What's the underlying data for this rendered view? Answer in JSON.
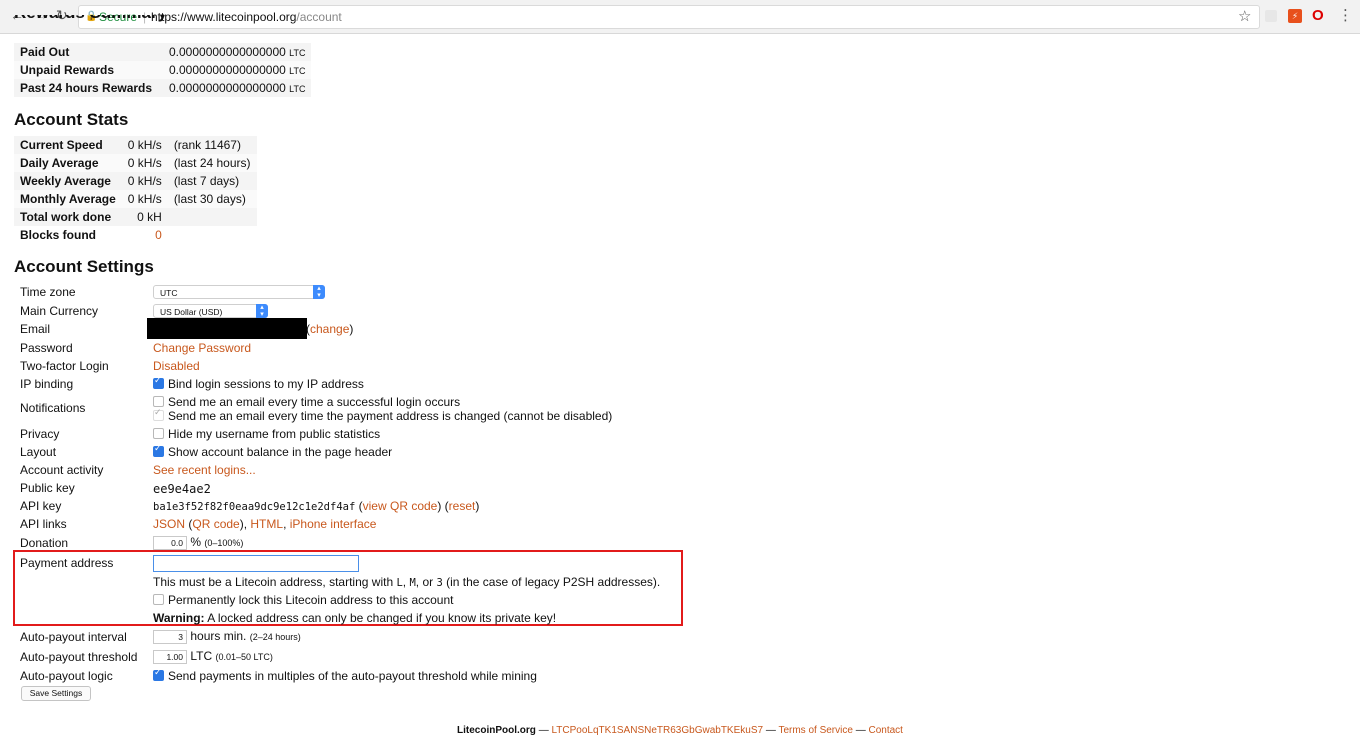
{
  "browser": {
    "secure_label": "Secure",
    "url_host": "https://www.litecoinpool.org",
    "url_path": "/account"
  },
  "rewards": {
    "heading": "Rewards Summary",
    "rows": [
      {
        "label": "Paid Out",
        "value": "0.0000000000000000",
        "unit": "LTC"
      },
      {
        "label": "Unpaid Rewards",
        "value": "0.0000000000000000",
        "unit": "LTC"
      },
      {
        "label": "Past 24 hours Rewards",
        "value": "0.0000000000000000",
        "unit": "LTC"
      }
    ]
  },
  "stats": {
    "heading": "Account Stats",
    "rows": [
      {
        "label": "Current Speed",
        "value": "0 kH/s",
        "note": "(rank 11467)"
      },
      {
        "label": "Daily Average",
        "value": "0 kH/s",
        "note": "(last 24 hours)"
      },
      {
        "label": "Weekly Average",
        "value": "0 kH/s",
        "note": "(last 7 days)"
      },
      {
        "label": "Monthly Average",
        "value": "0 kH/s",
        "note": "(last 30 days)"
      },
      {
        "label": "Total work done",
        "value": "0 kH",
        "note": ""
      },
      {
        "label": "Blocks found",
        "value": "0",
        "note": ""
      }
    ]
  },
  "settings": {
    "heading": "Account Settings",
    "timezone": {
      "label": "Time zone",
      "value": "UTC"
    },
    "currency": {
      "label": "Main Currency",
      "value": "US Dollar (USD)"
    },
    "email": {
      "label": "Email",
      "change": "change",
      "open_paren": "(",
      "close_paren": ")"
    },
    "password": {
      "label": "Password",
      "link": "Change Password"
    },
    "twofactor": {
      "label": "Two-factor Login",
      "link": "Disabled"
    },
    "ipbinding": {
      "label": "IP binding",
      "option": "Bind login sessions to my IP address"
    },
    "notifications": {
      "label": "Notifications",
      "option1": "Send me an email every time a successful login occurs",
      "option2": "Send me an email every time the payment address is changed (cannot be disabled)"
    },
    "privacy": {
      "label": "Privacy",
      "option": "Hide my username from public statistics"
    },
    "layout": {
      "label": "Layout",
      "option": "Show account balance in the page header"
    },
    "activity": {
      "label": "Account activity",
      "link": "See recent logins..."
    },
    "publickey": {
      "label": "Public key",
      "value": "ee9e4ae2"
    },
    "apikey": {
      "label": "API key",
      "value": "ba1e3f52f82f0eaa9dc9e12c1e2df4af",
      "qr": "view QR code",
      "reset": "reset"
    },
    "apilinks": {
      "label": "API links",
      "json": "JSON",
      "qr": "QR code",
      "html": "HTML",
      "iphone": "iPhone interface"
    },
    "donation": {
      "label": "Donation",
      "value": "0.0",
      "suffix": "%",
      "hint": "(0–100%)"
    },
    "payment": {
      "label": "Payment address",
      "help_prefix": "This must be a Litecoin address, starting with ",
      "prefix_l": "L",
      "prefix_m": "M",
      "prefix_3": "3",
      "help_suffix": " (in the case of legacy P2SH addresses).",
      "lock_option": "Permanently lock this Litecoin address to this account",
      "warning_bold": "Warning:",
      "warning_text": " A locked address can only be changed if you know its private key!"
    },
    "interval": {
      "label": "Auto-payout interval",
      "value": "3",
      "suffix": "hours min.",
      "hint": "(2–24 hours)"
    },
    "threshold": {
      "label": "Auto-payout threshold",
      "value": "1.00",
      "suffix": "LTC",
      "hint": "(0.01–50 LTC)"
    },
    "logic": {
      "label": "Auto-payout logic",
      "option": "Send payments in multiples of the auto-payout threshold while mining"
    },
    "save_label": "Save Settings"
  },
  "footer": {
    "site": "LitecoinPool.org",
    "dash": " — ",
    "donation_address": "LTCPooLqTK1SANSNeTR63GbGwabTKEkuS7",
    "tos": "Terms of Service",
    "contact": "Contact"
  }
}
